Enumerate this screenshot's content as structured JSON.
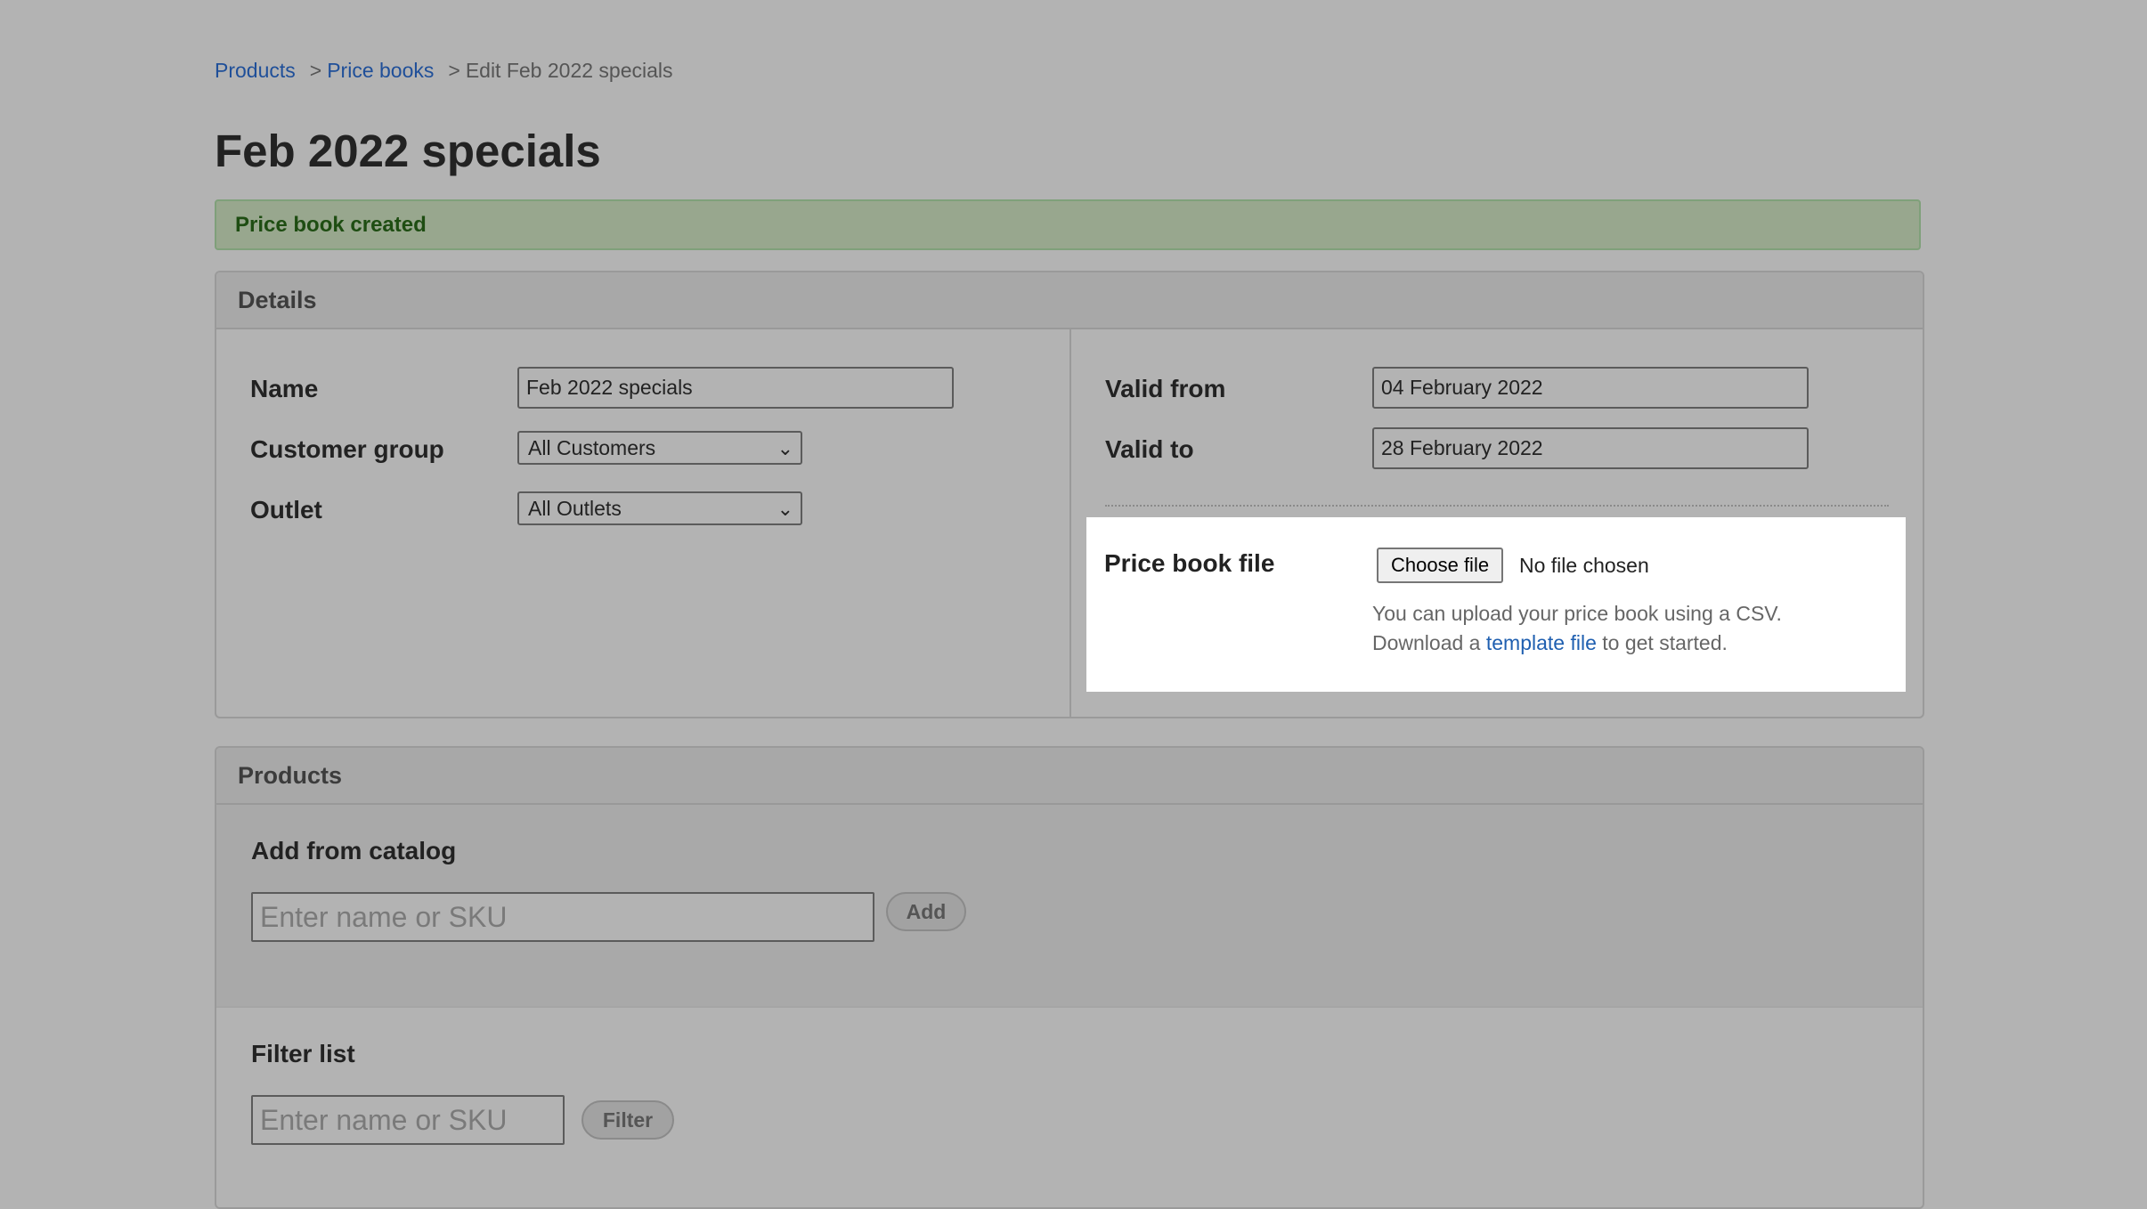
{
  "breadcrumb": {
    "items": [
      {
        "label": "Products",
        "link": true
      },
      {
        "label": "Price books",
        "link": true
      },
      {
        "label": "Edit Feb 2022 specials",
        "link": false
      }
    ],
    "separator": ">"
  },
  "page_title": "Feb 2022 specials",
  "alert": {
    "text": "Price book created",
    "color": "#1e4d12"
  },
  "details": {
    "header": "Details",
    "name": {
      "label": "Name",
      "value": "Feb 2022 specials"
    },
    "customer_group": {
      "label": "Customer group",
      "value": "All Customers"
    },
    "outlet": {
      "label": "Outlet",
      "value": "All Outlets"
    },
    "valid_from": {
      "label": "Valid from",
      "value": "04 February 2022"
    },
    "valid_to": {
      "label": "Valid to",
      "value": "28 February 2022"
    },
    "price_book_file": {
      "label": "Price book file",
      "button": "Choose file",
      "status": "No file chosen",
      "help_line1": "You can upload your price book using a CSV.",
      "help_prefix": "Download a",
      "help_link": "template file",
      "help_suffix": "to get started."
    }
  },
  "products": {
    "header": "Products",
    "add_from_catalog": {
      "title": "Add from catalog",
      "placeholder": "Enter name or SKU",
      "button": "Add"
    },
    "filter_list": {
      "title": "Filter list",
      "placeholder": "Enter name or SKU",
      "button": "Filter"
    }
  },
  "colors": {
    "background": "#b3b3b3",
    "link": "#1f4f99",
    "alert_bg": "#98a78e"
  }
}
